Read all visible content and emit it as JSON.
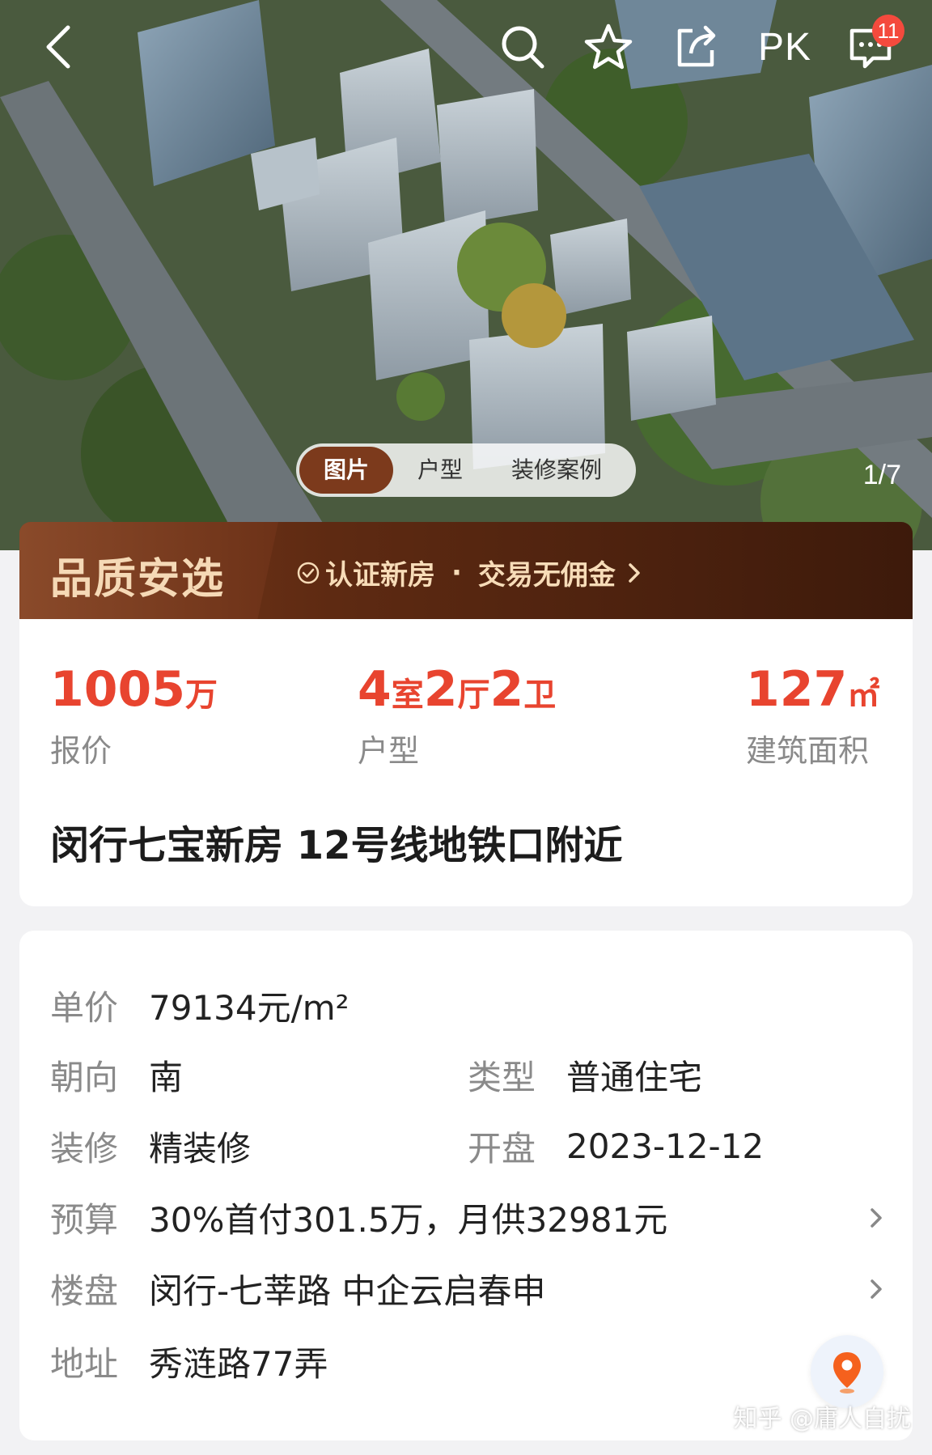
{
  "header": {
    "badge_count": "11",
    "pk_label": "PK",
    "icons": [
      "back-arrow-icon",
      "search-icon",
      "star-icon",
      "share-icon",
      "message-icon"
    ]
  },
  "media": {
    "tabs": [
      "图片",
      "户型",
      "装修案例"
    ],
    "active_tab": "图片",
    "counter": "1/7"
  },
  "banner": {
    "title": "品质安选",
    "item1": "认证新房",
    "dot": "·",
    "item2": "交易无佣金"
  },
  "summary": {
    "price": {
      "value": "1005",
      "unit": "万",
      "label": "报价"
    },
    "layout": {
      "n1": "4",
      "u1": "室",
      "n2": "2",
      "u2": "厅",
      "n3": "2",
      "u3": "卫",
      "label": "户型"
    },
    "area": {
      "value": "127",
      "unit": "㎡",
      "label": "建筑面积"
    },
    "title": "闵行七宝新房 12号线地铁口附近"
  },
  "details": {
    "unit_price": {
      "key": "单价",
      "value": "79134元/m²"
    },
    "orientation": {
      "key": "朝向",
      "value": "南"
    },
    "type": {
      "key": "类型",
      "value": "普通住宅"
    },
    "decoration": {
      "key": "装修",
      "value": "精装修"
    },
    "opening": {
      "key": "开盘",
      "value": "2023-12-12"
    },
    "budget": {
      "key": "预算",
      "value": "30%首付301.5万，月供32981元"
    },
    "project": {
      "key": "楼盘",
      "value": "闵行-七莘路 中企云启春申"
    },
    "address": {
      "key": "地址",
      "value": "秀涟路77弄"
    }
  },
  "watermark": "知乎 @庸人自扰",
  "colors": {
    "accent": "#e8442f",
    "banner_brown": "#6d3218",
    "tab_active": "#7c3a1c"
  }
}
